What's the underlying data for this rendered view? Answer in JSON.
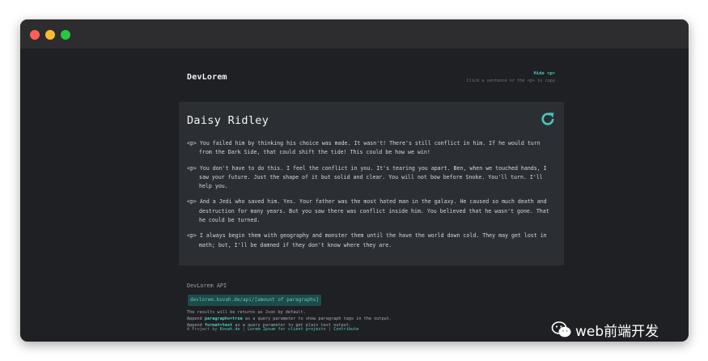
{
  "header": {
    "brand": "DevLorem",
    "hide_link": "Hide <p>",
    "copy_hint": "Click a sentence or the <p> to copy"
  },
  "card": {
    "title": "Daisy Ridley",
    "refresh_icon": "refresh-icon",
    "accent_color": "#49c5b6",
    "paragraphs": [
      {
        "tag": "<p>",
        "text": "You failed him by thinking his choice was made. It wasn't! There's still conflict in him. If he would turn from the Dark Side, that could shift the tide! This could be how we win!"
      },
      {
        "tag": "<p>",
        "text": "You don't have to do this. I feel the conflict in you. It's tearing you apart. Ben, when we touched hands, I saw your future. Just the shape of it but solid and clear. You will not bow before Snoke. You'll turn. I'll help you."
      },
      {
        "tag": "<p>",
        "text": "And a Jedi who saved him. Yes. Your father was the most hated man in the galaxy. He caused so much death and destruction for many years. But you saw there was conflict inside him. You believed that he wasn't gone. That he could be turned."
      },
      {
        "tag": "<p>",
        "text": "I always begin them with geography and monster them until the have the world down cold. They may get lost in math; but, I'll be damned if they don't know where they are."
      }
    ]
  },
  "api": {
    "title": "DevLorem API",
    "url": "devlorem.kovah.de/api/[amount of paragraphs]",
    "line1": "The results will be returns as Json by default.",
    "line2_pre": "Append ",
    "line2_param": "paragraphs=true",
    "line2_post": " as a query parameter to show paragraph tags in the output.",
    "line3_pre": "Append ",
    "line3_param": "format=text",
    "line3_post": " as a query parameter to get plain text output."
  },
  "footer": {
    "prefix": "A Project by ",
    "author": "Kovah.de",
    "sep1": " | ",
    "link2": "Lorem Ipsum for client projects",
    "sep2": " | ",
    "link3": "Contribute"
  },
  "watermark": {
    "text": "web前端开发",
    "icon": "wechat-icon"
  }
}
